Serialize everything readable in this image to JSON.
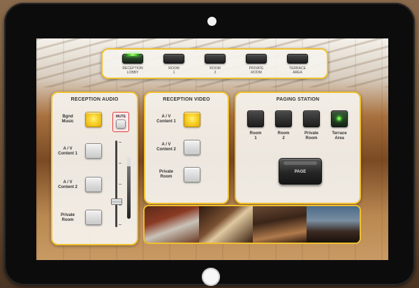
{
  "rooms": {
    "items": [
      {
        "line1": "RECEPTION",
        "line2": "LOBBY",
        "active": true
      },
      {
        "line1": "ROOM",
        "line2": "1",
        "active": false
      },
      {
        "line1": "ROOM",
        "line2": "2",
        "active": false
      },
      {
        "line1": "PRIVATE",
        "line2": "ROOM",
        "active": false
      },
      {
        "line1": "TERRACE",
        "line2": "AREA",
        "active": false
      }
    ]
  },
  "reception_audio": {
    "title": "RECEPTION AUDIO",
    "sources": [
      {
        "line1": "Bgnd",
        "line2": "Music",
        "active": true
      },
      {
        "line1": "A / V",
        "line2": "Content 1",
        "active": false
      },
      {
        "line1": "A / V",
        "line2": "Content 2",
        "active": false
      },
      {
        "line1": "Private",
        "line2": "Room",
        "active": false
      }
    ],
    "mute_label": "MUTE"
  },
  "reception_video": {
    "title": "RECEPTION VIDEO",
    "sources": [
      {
        "line1": "A / V",
        "line2": "Content 1",
        "active": true
      },
      {
        "line1": "A / V",
        "line2": "Content 2",
        "active": false
      },
      {
        "line1": "Private",
        "line2": "Room",
        "active": false
      }
    ]
  },
  "paging_station": {
    "title": "PAGING STATION",
    "zones": [
      {
        "line1": "Room",
        "line2": "1",
        "active": false
      },
      {
        "line1": "Room",
        "line2": "2",
        "active": false
      },
      {
        "line1": "Private",
        "line2": "Room",
        "active": false
      },
      {
        "line1": "Terrace",
        "line2": "Area",
        "active": true
      }
    ],
    "page_label": "PAGE"
  },
  "colors": {
    "accent": "#f0c030",
    "active_button": "#f8d22a",
    "mute_border": "#e23a3a",
    "led_green": "#3fbf2a"
  }
}
